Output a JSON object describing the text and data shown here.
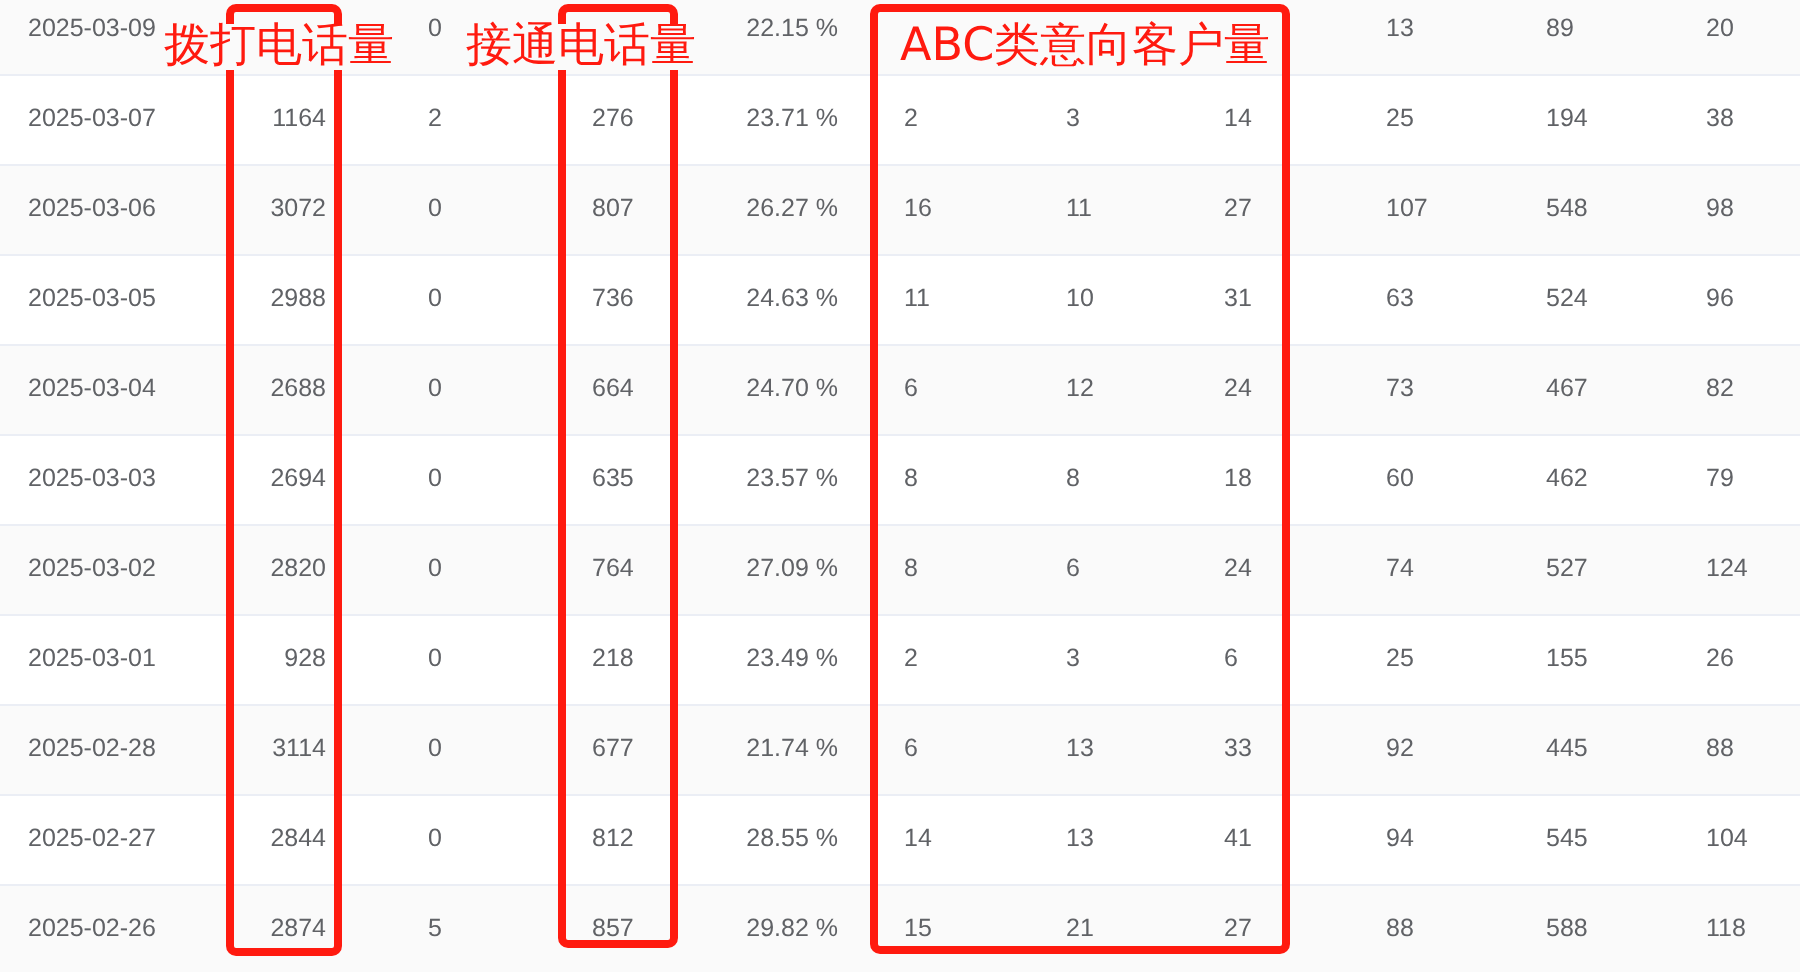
{
  "table": {
    "rows": [
      {
        "cells": [
          "2025-03-09",
          null,
          "0",
          null,
          "22.15 %",
          null,
          null,
          null,
          "13",
          "89",
          "20"
        ]
      },
      {
        "cells": [
          "2025-03-07",
          "1164",
          "2",
          "276",
          "23.71 %",
          "2",
          "3",
          "14",
          "25",
          "194",
          "38"
        ]
      },
      {
        "cells": [
          "2025-03-06",
          "3072",
          "0",
          "807",
          "26.27 %",
          "16",
          "11",
          "27",
          "107",
          "548",
          "98"
        ]
      },
      {
        "cells": [
          "2025-03-05",
          "2988",
          "0",
          "736",
          "24.63 %",
          "11",
          "10",
          "31",
          "63",
          "524",
          "96"
        ]
      },
      {
        "cells": [
          "2025-03-04",
          "2688",
          "0",
          "664",
          "24.70 %",
          "6",
          "12",
          "24",
          "73",
          "467",
          "82"
        ]
      },
      {
        "cells": [
          "2025-03-03",
          "2694",
          "0",
          "635",
          "23.57 %",
          "8",
          "8",
          "18",
          "60",
          "462",
          "79"
        ]
      },
      {
        "cells": [
          "2025-03-02",
          "2820",
          "0",
          "764",
          "27.09 %",
          "8",
          "6",
          "24",
          "74",
          "527",
          "124"
        ]
      },
      {
        "cells": [
          "2025-03-01",
          "928",
          "0",
          "218",
          "23.49 %",
          "2",
          "3",
          "6",
          "25",
          "155",
          "26"
        ]
      },
      {
        "cells": [
          "2025-02-28",
          "3114",
          "0",
          "677",
          "21.74 %",
          "6",
          "13",
          "33",
          "92",
          "445",
          "88"
        ]
      },
      {
        "cells": [
          "2025-02-27",
          "2844",
          "0",
          "812",
          "28.55 %",
          "14",
          "13",
          "41",
          "94",
          "545",
          "104"
        ]
      },
      {
        "cells": [
          "2025-02-26",
          "2874",
          "5",
          "857",
          "29.82 %",
          "15",
          "21",
          "27",
          "88",
          "588",
          "118"
        ]
      }
    ]
  },
  "annotations": [
    {
      "label": "拨打电话量"
    },
    {
      "label": "接通电话量"
    },
    {
      "label": "ABC类意向客户量"
    }
  ]
}
